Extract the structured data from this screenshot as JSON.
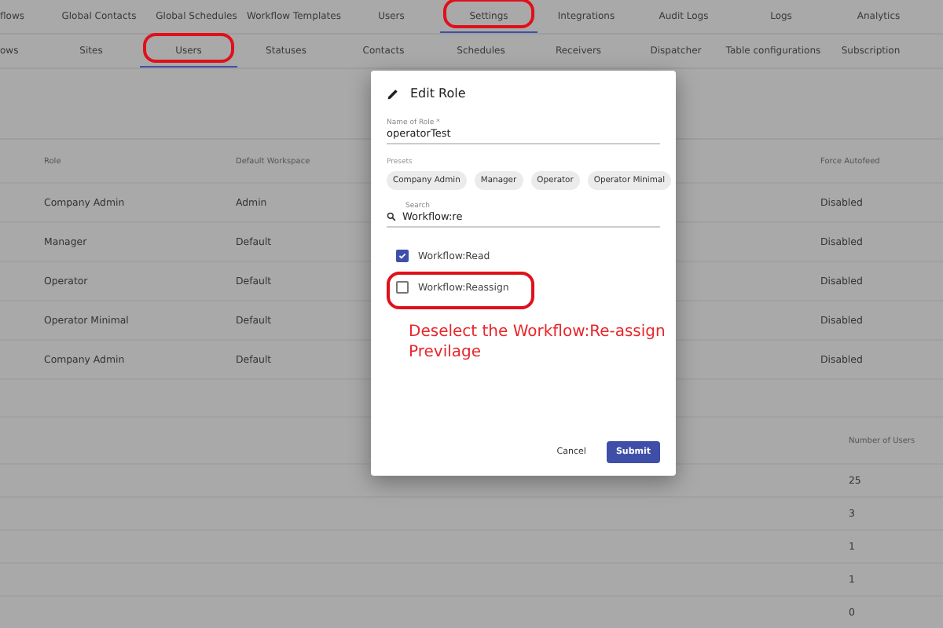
{
  "top_nav": [
    {
      "label": "flows",
      "selected": false,
      "highlighted": false
    },
    {
      "label": "Global Contacts",
      "selected": false,
      "highlighted": false
    },
    {
      "label": "Global Schedules",
      "selected": false,
      "highlighted": false
    },
    {
      "label": "Workflow Templates",
      "selected": false,
      "highlighted": false
    },
    {
      "label": "Users",
      "selected": false,
      "highlighted": false
    },
    {
      "label": "Settings",
      "selected": true,
      "highlighted": true
    },
    {
      "label": "Integrations",
      "selected": false,
      "highlighted": false
    },
    {
      "label": "Audit Logs",
      "selected": false,
      "highlighted": false
    },
    {
      "label": "Logs",
      "selected": false,
      "highlighted": false
    },
    {
      "label": "Analytics",
      "selected": false,
      "highlighted": false
    }
  ],
  "sub_nav": [
    {
      "label": "ows",
      "selected": false,
      "highlighted": false
    },
    {
      "label": "Sites",
      "selected": false,
      "highlighted": false
    },
    {
      "label": "Users",
      "selected": true,
      "highlighted": true
    },
    {
      "label": "Statuses",
      "selected": false,
      "highlighted": false
    },
    {
      "label": "Contacts",
      "selected": false,
      "highlighted": false
    },
    {
      "label": "Schedules",
      "selected": false,
      "highlighted": false
    },
    {
      "label": "Receivers",
      "selected": false,
      "highlighted": false
    },
    {
      "label": "Dispatcher",
      "selected": false,
      "highlighted": false
    },
    {
      "label": "Table configurations",
      "selected": false,
      "highlighted": false
    },
    {
      "label": "Subscription",
      "selected": false,
      "highlighted": false
    }
  ],
  "roles_table": {
    "columns": [
      "Role",
      "Default Workspace",
      "Force Autofeed"
    ],
    "rows": [
      [
        "Company Admin",
        "Admin",
        "Disabled"
      ],
      [
        "Manager",
        "Default",
        "Disabled"
      ],
      [
        "Operator",
        "Default",
        "Disabled"
      ],
      [
        "Operator Minimal",
        "Default",
        "Disabled"
      ],
      [
        "Company Admin",
        "Default",
        "Disabled"
      ]
    ]
  },
  "users_table": {
    "columns": [
      "Number of Users"
    ],
    "rows": [
      [
        "25"
      ],
      [
        "3"
      ],
      [
        "1"
      ],
      [
        "1"
      ],
      [
        "0"
      ]
    ]
  },
  "dialog": {
    "title": "Edit Role",
    "name_field": {
      "label": "Name of Role *",
      "value": "operatorTest"
    },
    "presets_label": "Presets",
    "presets": [
      "Company Admin",
      "Manager",
      "Operator",
      "Operator Minimal"
    ],
    "search": {
      "label": "Search",
      "value": "Workflow:re"
    },
    "permissions": [
      {
        "label": "Workflow:Read",
        "checked": true,
        "highlighted": false
      },
      {
        "label": "Workflow:Reassign",
        "checked": false,
        "highlighted": true
      }
    ],
    "annotation": "Deselect the Workflow:Re-assign Previlage",
    "buttons": [
      "Cancel",
      "Submit"
    ]
  }
}
